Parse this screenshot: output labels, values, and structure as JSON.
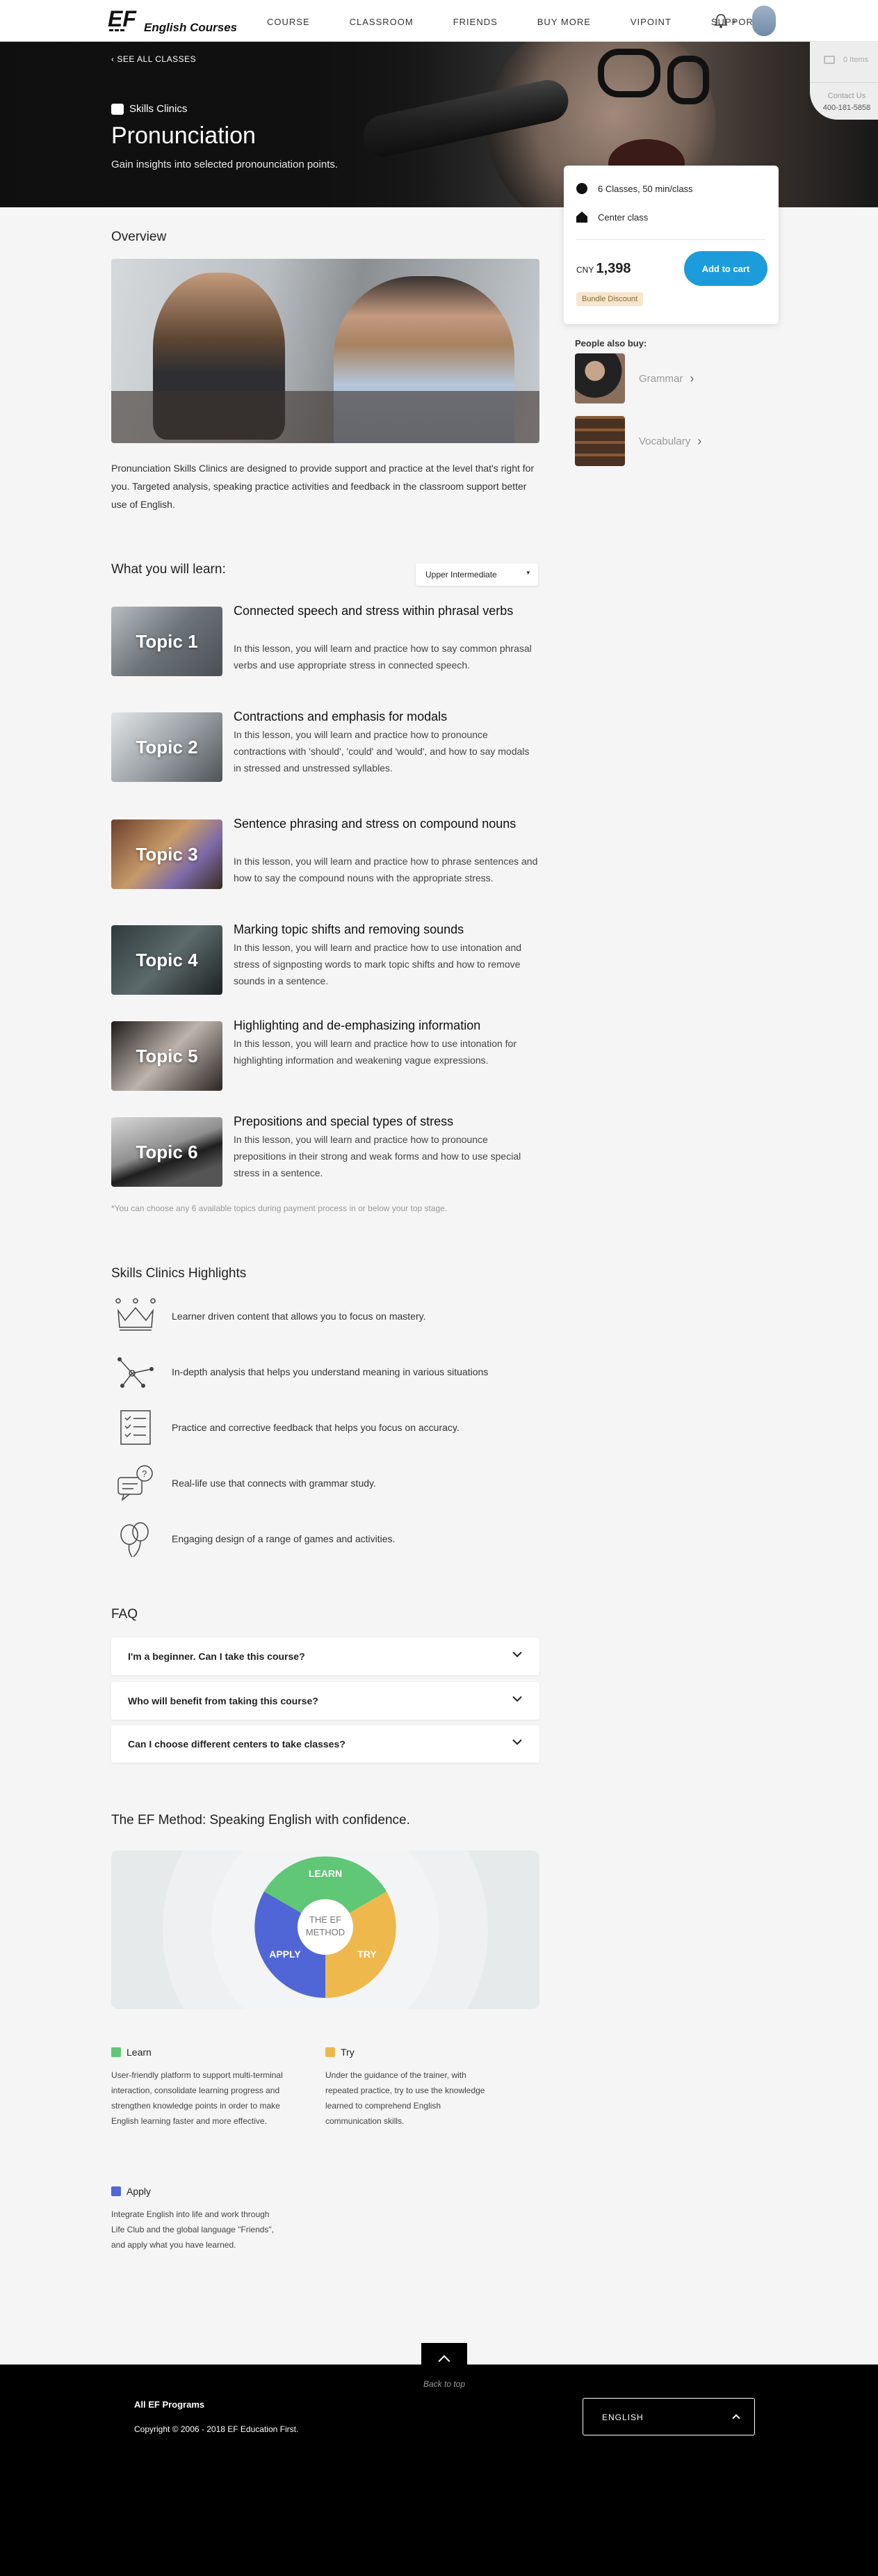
{
  "header": {
    "logo_text": "EF",
    "logo_sub": "English Courses",
    "nav": [
      "COURSE",
      "CLASSROOM",
      "FRIENDS",
      "BUY MORE",
      "VIPOINT",
      "SUPPORT"
    ]
  },
  "hero": {
    "back_link": "SEE ALL CLASSES",
    "tag": "Skills Clinics",
    "title": "Pronunciation",
    "subtitle": "Gain insights into selected pronounciation points."
  },
  "side_tab": {
    "cart": "0 Items",
    "contact_label": "Contact Us",
    "phone": "400-181-5858"
  },
  "card": {
    "classes": "6 Classes, 50 min/class",
    "location": "Center class",
    "currency": "CNY",
    "price": "1,398",
    "add_to_cart": "Add to cart",
    "bundle": "Bundle Discount"
  },
  "also_buy": {
    "label": "People also buy:",
    "items": [
      {
        "label": "Grammar"
      },
      {
        "label": "Vocabulary"
      }
    ]
  },
  "overview": {
    "heading": "Overview",
    "text": "Pronunciation Skills Clinics are designed to provide support and practice at the level that's right for you. Targeted analysis, speaking practice activities and feedback in the classroom support better use of English."
  },
  "learn": {
    "heading": "What you will learn:",
    "level": "Upper Intermediate",
    "topics": [
      {
        "tag": "Topic 1",
        "title": "Connected speech and stress within phrasal verbs",
        "desc": "In this lesson, you will learn and practice how to say common phrasal verbs and use appropriate stress in connected speech."
      },
      {
        "tag": "Topic 2",
        "title": "Contractions and emphasis for modals",
        "desc": "In this lesson, you will learn and practice how to pronounce contractions with 'should', 'could' and 'would', and how to say modals in stressed and unstressed syllables."
      },
      {
        "tag": "Topic 3",
        "title": "Sentence phrasing and stress on compound nouns",
        "desc": "In this lesson, you will learn and practice how to phrase sentences and how to say the compound nouns with the appropriate stress."
      },
      {
        "tag": "Topic 4",
        "title": "Marking topic shifts and removing sounds",
        "desc": "In this lesson, you will learn and practice how to use intonation and stress of signposting words to mark topic shifts and how to remove sounds in a sentence."
      },
      {
        "tag": "Topic 5",
        "title": "Highlighting and de-emphasizing information",
        "desc": "In this lesson, you will learn and practice how to use intonation for highlighting information and weakening vague expressions."
      },
      {
        "tag": "Topic 6",
        "title": "Prepositions and special types of stress",
        "desc": "In this lesson, you will learn and practice how to pronounce prepositions in their strong and weak forms and how to use special stress in a sentence."
      }
    ],
    "note": "*You can choose any 6 available topics during payment process in or below your top stage."
  },
  "highlights": {
    "heading": "Skills Clinics Highlights",
    "items": [
      {
        "icon": "crown-icon",
        "text": "Learner driven content that allows you to focus on mastery."
      },
      {
        "icon": "analysis-icon",
        "text": "In-depth analysis that helps you understand meaning in various situations"
      },
      {
        "icon": "checklist-icon",
        "text": "Practice and corrective feedback that helps you focus on accuracy."
      },
      {
        "icon": "chat-icon",
        "text": "Real-life use that connects with grammar study."
      },
      {
        "icon": "balloons-icon",
        "text": "Engaging design of a range of games and activities."
      }
    ]
  },
  "faq": {
    "heading": "FAQ",
    "items": [
      {
        "q": "I'm a beginner. Can I take this course?"
      },
      {
        "q": "Who will benefit from taking this course?"
      },
      {
        "q": "Can I choose different centers to take classes?"
      }
    ]
  },
  "method": {
    "heading": "The EF Method: Speaking English with confidence.",
    "center_line1": "THE EF",
    "center_line2": "METHOD",
    "segments": [
      {
        "label": "LEARN",
        "color": "#5fc775"
      },
      {
        "label": "TRY",
        "color": "#eeb84d"
      },
      {
        "label": "APPLY",
        "color": "#5066d6"
      }
    ],
    "legend": [
      {
        "label": "Learn",
        "desc": "User-friendly platform to support multi-terminal interaction, consolidate learning progress and strengthen knowledge points in order to make English learning faster and more effective."
      },
      {
        "label": "Try",
        "desc": "Under the guidance of the trainer, with repeated practice, try to use the knowledge learned to comprehend English communication skills."
      },
      {
        "label": "Apply",
        "desc": "Integrate English into life and work through Life Club and the global language \"Friends\", and apply what you have learned."
      }
    ]
  },
  "back_to_top": "Back to top",
  "footer": {
    "title": "All EF Programs",
    "copyright": "Copyright © 2006 - 2018 EF Education First.",
    "language": "ENGLISH"
  }
}
